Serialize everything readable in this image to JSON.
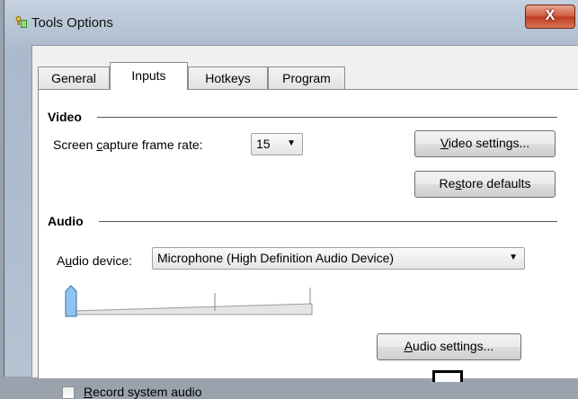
{
  "window": {
    "title": "Tools Options",
    "close_glyph": "X"
  },
  "tabs": [
    {
      "label": "General",
      "active": false
    },
    {
      "label": "Inputs",
      "active": true
    },
    {
      "label": "Hotkeys",
      "active": false
    },
    {
      "label": "Program",
      "active": false
    }
  ],
  "video": {
    "header": "Video",
    "frame_rate_label": "Screen capture frame rate:",
    "frame_rate_value": "15",
    "settings_button": "Video settings...",
    "restore_button": "Restore defaults"
  },
  "audio": {
    "header": "Audio",
    "device_label": "Audio device:",
    "device_value": "Microphone (High Definition Audio Device)",
    "volume_level": 0,
    "settings_button": "Audio settings...",
    "record_system_label": "Record system audio",
    "record_system_checked": false
  },
  "icons": {
    "app": "pin-icon",
    "dropdown": "chevron-down-icon"
  },
  "colors": {
    "close_button": "#c03c1c",
    "title_bar": "#c6d2e0",
    "slider_thumb": "#7fb2e0"
  }
}
